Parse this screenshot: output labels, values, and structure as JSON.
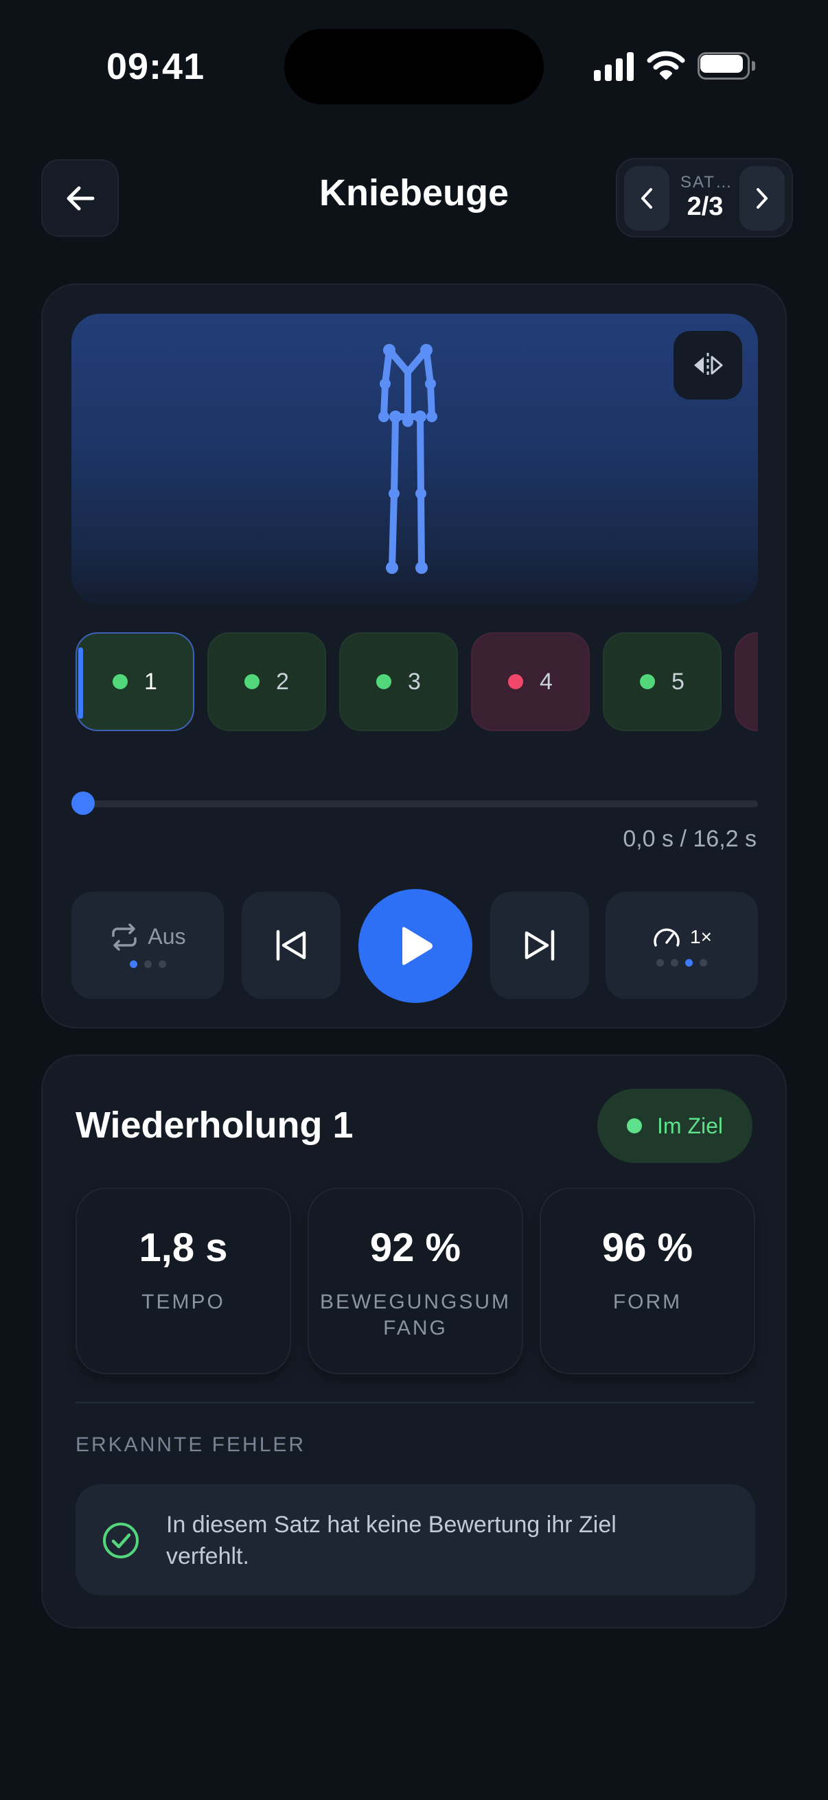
{
  "status_bar": {
    "time": "09:41"
  },
  "header": {
    "title": "Kniebeuge",
    "set_label": "SAT…",
    "set_value": "2/3"
  },
  "player": {
    "reps": [
      {
        "label": "1",
        "status": "ok",
        "selected": true
      },
      {
        "label": "2",
        "status": "ok"
      },
      {
        "label": "3",
        "status": "ok"
      },
      {
        "label": "4",
        "status": "bad"
      },
      {
        "label": "5",
        "status": "ok"
      },
      {
        "label": "",
        "status": "bad"
      }
    ],
    "progress": 0,
    "time_readout": "0,0 s / 16,2 s",
    "loop_label": "Aus",
    "speed_label": "1×"
  },
  "stats": {
    "title": "Wiederholung 1",
    "status": "Im Ziel",
    "metrics": [
      {
        "value": "1,8 s",
        "label": "TEMPO"
      },
      {
        "value": "92 %",
        "label": "BEWEGUNGSUMFANG"
      },
      {
        "value": "96 %",
        "label": "FORM"
      }
    ],
    "section_label": "ERKANNTE FEHLER",
    "message": "In diesem Satz hat keine Bewertung ihr Ziel verfehlt."
  },
  "colors": {
    "accent": "#3e7bff",
    "ok": "#52d87a",
    "bad": "#f0476a",
    "background": "#0d1118"
  }
}
